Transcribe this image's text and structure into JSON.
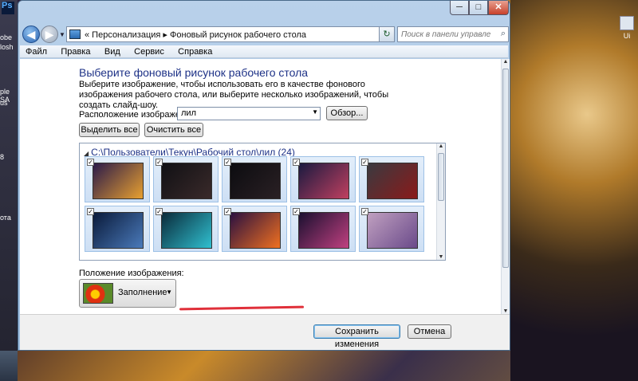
{
  "desktop": {
    "left_icons": [
      "Ps",
      "obe",
      "losh",
      "ple SA",
      "us",
      "8",
      "отa"
    ],
    "right_icon": "Ui"
  },
  "window": {
    "controls": {
      "minimize": "─",
      "maximize": "□",
      "close": "✕"
    }
  },
  "navbar": {
    "breadcrumb": "«  Персонализация  ▸  Фоновый рисунок рабочего стола",
    "search_placeholder": "Поиск в панели управления"
  },
  "menu": {
    "items": [
      "Файл",
      "Правка",
      "Вид",
      "Сервис",
      "Справка"
    ]
  },
  "content": {
    "heading": "Выберите фоновый рисунок рабочего стола",
    "description": "Выберите изображение, чтобы использовать его в качестве фонового изображения рабочего стола, или выберите несколько изображений, чтобы создать слайд-шоу.",
    "location_label": "Расположение изображения:",
    "location_value": "лил",
    "browse_label": "Обзор...",
    "select_all_label": "Выделить все",
    "clear_all_label": "Очистить все",
    "gallery_path": "C:\\Пользователи\\Текун\\Рабочий стол\\лил (24)",
    "position_label": "Положение изображения:",
    "position_value": "Заполнение"
  },
  "tiles": [
    {
      "colors": [
        "#2a1a4a",
        "#e8a030"
      ]
    },
    {
      "colors": [
        "#101014",
        "#3a2a2a"
      ]
    },
    {
      "colors": [
        "#0c0c10",
        "#2a2024"
      ]
    },
    {
      "colors": [
        "#1a1a40",
        "#c04060"
      ]
    },
    {
      "colors": [
        "#3a3a40",
        "#8a1a1a"
      ]
    },
    {
      "colors": [
        "#0a1a3a",
        "#4a7aba"
      ]
    },
    {
      "colors": [
        "#0a2a3a",
        "#30c0d0"
      ]
    },
    {
      "colors": [
        "#2a1040",
        "#f07020"
      ]
    },
    {
      "colors": [
        "#1a1030",
        "#c04080"
      ]
    },
    {
      "colors": [
        "#c0a0c0",
        "#6a4a8a"
      ]
    }
  ],
  "footer": {
    "save_label": "Сохранить изменения",
    "cancel_label": "Отмена"
  }
}
